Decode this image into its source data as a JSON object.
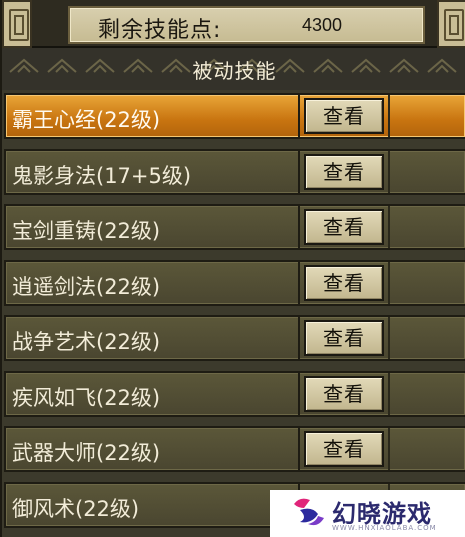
{
  "header": {
    "points_label": "剩余技能点:",
    "points_value": "4300"
  },
  "section": {
    "title": "被动技能"
  },
  "skills": [
    {
      "name": "霸王心经(22级)",
      "button": "查看",
      "selected": true
    },
    {
      "name": "鬼影身法(17+5级)",
      "button": "查看",
      "selected": false
    },
    {
      "name": "宝剑重铸(22级)",
      "button": "查看",
      "selected": false
    },
    {
      "name": "逍遥剑法(22级)",
      "button": "查看",
      "selected": false
    },
    {
      "name": "战争艺术(22级)",
      "button": "查看",
      "selected": false
    },
    {
      "name": "疾风如飞(22级)",
      "button": "查看",
      "selected": false
    },
    {
      "name": "武器大师(22级)",
      "button": "查看",
      "selected": false
    },
    {
      "name": "御风术(22级)",
      "button": "",
      "selected": false
    }
  ],
  "watermark": {
    "text": "幻晓游戏",
    "subtext": "WWW.HNXIAOLABA.COM"
  },
  "colors": {
    "selected_row": "#c87410",
    "row": "#4e4a32",
    "button": "#d4c9a3"
  }
}
